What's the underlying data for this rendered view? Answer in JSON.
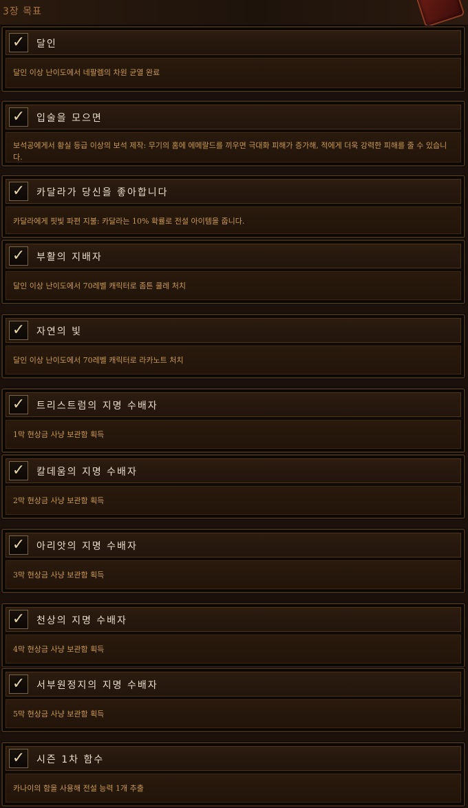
{
  "header": {
    "title": "3장 목표"
  },
  "objectives": [
    {
      "title": "달인",
      "desc": "달인 이상 난이도에서 네팔렘의 차원 균열 완료",
      "completed": true
    },
    {
      "title": "입술을 모으면",
      "desc": "보석공에게서 황실 등급 이상의 보석 제작: 무기의 홈에 에메랄드를 끼우면 극대화 피해가 증가해, 적에게 더욱 강력한 피해를 줄 수 있습니다.",
      "completed": true
    },
    {
      "title": "카달라가 당신을 좋아합니다",
      "desc": "카달라에게 핏빛 파편 지불: 카달라는 10% 확률로 전설 아이템을 줍니다.",
      "completed": true
    },
    {
      "title": "부활의 지배자",
      "desc": "달인 이상 난이도에서 70레벨 캐릭터로 좀튼 쿨레 처치",
      "completed": true
    },
    {
      "title": "자연의 빛",
      "desc": "달인 이상 난이도에서 70레벨 캐릭터로 라카노트 처치",
      "completed": true
    },
    {
      "title": "트리스트럼의 지명 수배자",
      "desc": "1막 현상금 사냥 보관함 획득",
      "completed": true
    },
    {
      "title": "칼데움의 지명 수배자",
      "desc": "2막 현상금 사냥 보관함 획득",
      "completed": true
    },
    {
      "title": "아리앗의 지명 수배자",
      "desc": "3막 현상금 사냥 보관함 획득",
      "completed": true
    },
    {
      "title": "천상의 지명 수배자",
      "desc": "4막 현상금 사냥 보관함 획득",
      "completed": true
    },
    {
      "title": "서부원정지의 지명 수배자",
      "desc": "5막 현상금 사냥 보관함 획득",
      "completed": true
    },
    {
      "title": "시즌 1차 함수",
      "desc": "카나이의 함을 사용해 전설 능력 1개 추출",
      "completed": true
    }
  ],
  "icons": {
    "check": "checkmark-icon",
    "emblem": "season-emblem-icon"
  },
  "colors": {
    "title": "#e6dccb",
    "desc": "#c99a55",
    "chapter": "#a8743d",
    "frame": "#3e2c1b"
  }
}
